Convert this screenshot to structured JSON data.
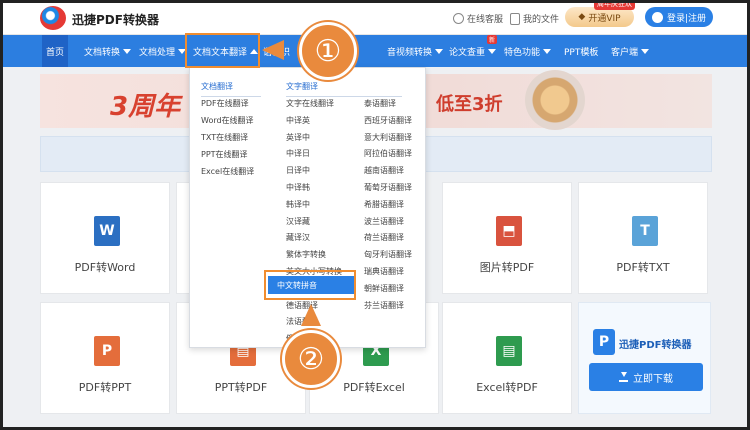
{
  "header": {
    "brand": "迅捷PDF转换器",
    "service": "在线客服",
    "my_files": "我的文件",
    "vip_badge": "周年庆狂欢",
    "vip": "开通VIP",
    "login": "登录|注册"
  },
  "nav": {
    "items": [
      "首页",
      "文档转换",
      "文档处理",
      "文档文本翻译",
      "语音识",
      "音视频转换",
      "论文查重",
      "特色功能",
      "PPT模板",
      "客户端"
    ],
    "new_badge": "新"
  },
  "banner": {
    "left_text": "3周年",
    "right_text": "低至3折"
  },
  "dropdown": {
    "col1_title": "文档翻译",
    "col1": [
      "PDF在线翻译",
      "Word在线翻译",
      "TXT在线翻译",
      "PPT在线翻译",
      "Excel在线翻译"
    ],
    "col2_title": "文字翻译",
    "col2": [
      "文字在线翻译",
      "中译英",
      "英译中",
      "中译日",
      "日译中",
      "中译韩",
      "韩译中",
      "汉译藏",
      "藏译汉",
      "繁体字转换",
      "英文大小写转换",
      "中文转拼音",
      "德语翻译",
      "法语翻译",
      "俄语翻译"
    ],
    "col3": [
      "泰语翻译",
      "西班牙语翻译",
      "意大利语翻译",
      "阿拉伯语翻译",
      "越南语翻译",
      "葡萄牙语翻译",
      "希腊语翻译",
      "波兰语翻译",
      "荷兰语翻译",
      "匈牙利语翻译",
      "瑞典语翻译",
      "朝鲜语翻译",
      "芬兰语翻译"
    ],
    "selected": "中文转拼音"
  },
  "cards": [
    {
      "label": "PDF转Word",
      "icon_letter": "W",
      "color": "#2b6fc2"
    },
    {
      "label": "图片转PDF",
      "icon_letter": "⬒",
      "color": "#d9533e"
    },
    {
      "label": "PDF转TXT",
      "icon_letter": "T",
      "color": "#5aa3d8"
    },
    {
      "label": "PDF转PPT",
      "icon_letter": "P",
      "color": "#e46d3b"
    },
    {
      "label": "PPT转PDF",
      "icon_letter": "▤",
      "color": "#e46d3b"
    },
    {
      "label": "PDF转Excel",
      "icon_letter": "X",
      "color": "#2e9b4f"
    },
    {
      "label": "Excel转PDF",
      "icon_letter": "▤",
      "color": "#2e9b4f"
    }
  ],
  "promo": {
    "title": "迅捷PDF转换器",
    "logo_letter": "P",
    "download": "立即下载"
  },
  "callouts": {
    "step1": "①",
    "step2": "②"
  },
  "colors": {
    "primary": "#2c7ee0",
    "accent": "#f08d30"
  }
}
